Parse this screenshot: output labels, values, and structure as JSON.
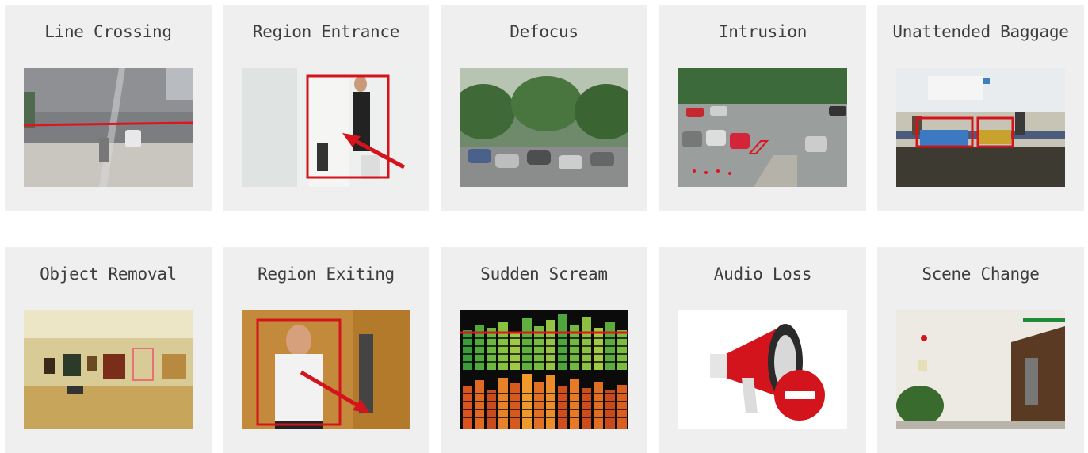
{
  "cards": [
    {
      "key": "line-crossing",
      "label": "Line Crossing"
    },
    {
      "key": "region-entrance",
      "label": "Region Entrance"
    },
    {
      "key": "defocus",
      "label": "Defocus"
    },
    {
      "key": "intrusion",
      "label": "Intrusion"
    },
    {
      "key": "unattended-baggage",
      "label": "Unattended Baggage"
    },
    {
      "key": "object-removal",
      "label": "Object Removal"
    },
    {
      "key": "region-exiting",
      "label": "Region Exiting"
    },
    {
      "key": "sudden-scream",
      "label": "Sudden Scream"
    },
    {
      "key": "audio-loss",
      "label": "Audio Loss"
    },
    {
      "key": "scene-change",
      "label": "Scene Change"
    }
  ]
}
